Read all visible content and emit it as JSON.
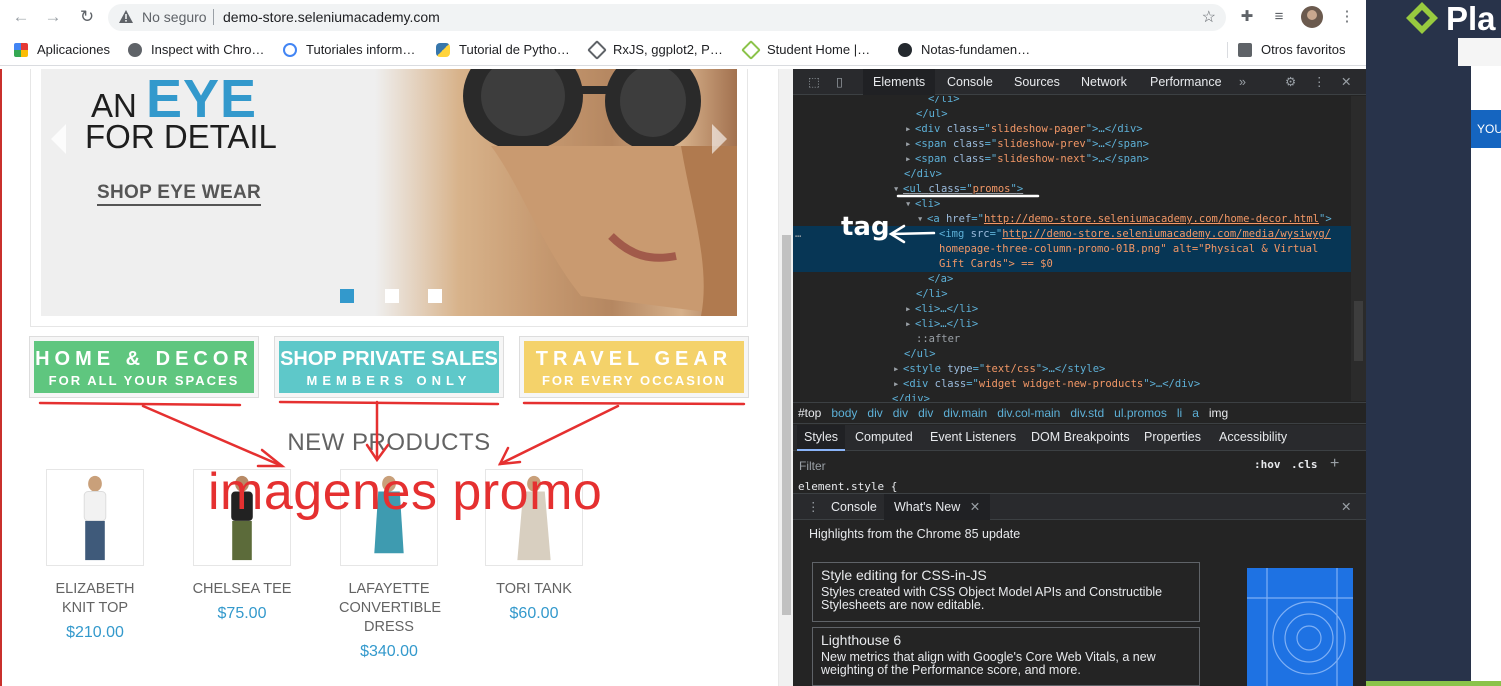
{
  "browser": {
    "insecure_label": "No seguro",
    "url": "demo-store.seleniumacademy.com",
    "bookmarks": [
      {
        "label": "Aplicaciones",
        "color": "#e53935"
      },
      {
        "label": "Inspect with Chro…",
        "color": "#5f6368"
      },
      {
        "label": "Tutoriales inform…",
        "color": "#4285f4"
      },
      {
        "label": "Tutorial de Pytho…",
        "color": "#3776ab"
      },
      {
        "label": "RxJS, ggplot2, P…",
        "color": "#5f6368"
      },
      {
        "label": "Student Home |…",
        "color": "#8bc34a"
      },
      {
        "label": "Notas-fundamen…",
        "color": "#24292e"
      }
    ],
    "other_bookmarks": "Otros favoritos"
  },
  "page": {
    "slide": {
      "line1_prefix": "AN",
      "line1_highlight": "EYE",
      "line2": "FOR DETAIL",
      "link": "SHOP EYE WEAR"
    },
    "promos": [
      {
        "title": "HOME & DECOR",
        "subtitle": "FOR ALL YOUR SPACES",
        "color": "#5fc67f"
      },
      {
        "title": "SHOP PRIVATE SALES",
        "subtitle": "MEMBERS ONLY",
        "color": "#5ec8c9"
      },
      {
        "title": "TRAVEL GEAR",
        "subtitle": "FOR EVERY OCCASION",
        "color": "#f4d26a"
      }
    ],
    "new_products_title": "NEW PRODUCTS",
    "products": [
      {
        "name": "ELIZABETH KNIT TOP",
        "price": "$210.00"
      },
      {
        "name": "CHELSEA TEE",
        "price": "$75.00"
      },
      {
        "name": "LAFAYETTE CONVERTIBLE DRESS",
        "price": "$340.00"
      },
      {
        "name": "TORI TANK",
        "price": "$60.00"
      }
    ]
  },
  "annotations": {
    "promo_label": "imagenes promo",
    "tag_label": "tag"
  },
  "devtools": {
    "tabs": [
      "Elements",
      "Console",
      "Sources",
      "Network",
      "Performance"
    ],
    "active_tab": "Elements",
    "dom_lines": [
      {
        "pre": "</li>"
      },
      {
        "pre": "</ul>"
      },
      {
        "tag": "div",
        "attr": "class",
        "val": "slideshow-pager",
        "post": ">…</div>"
      },
      {
        "tag": "span",
        "attr": "class",
        "val": "slideshow-prev",
        "post": ">…</span>"
      },
      {
        "tag": "span",
        "attr": "class",
        "val": "slideshow-next",
        "post": ">…</span>"
      },
      {
        "pre": "</div>"
      },
      {
        "tag": "ul",
        "attr": "class",
        "val": "promos",
        "post": ">"
      },
      {
        "pre": "<li>"
      },
      {
        "tag": "a",
        "attr": "href",
        "val": "http://demo-store.seleniumacademy.com/home-decor.html",
        "post": ">"
      },
      {
        "tag": "img",
        "attr": "src",
        "val": "http://demo-store.seleniumacademy.com/media/wysiwyg/"
      },
      {
        "pre": "homepage-three-column-promo-01B.png\" alt=\"Physical & Virtual"
      },
      {
        "pre": "Gift Cards\"> == $0"
      },
      {
        "pre": "</a>"
      },
      {
        "pre": "</li>"
      },
      {
        "pre": "<li>…</li>"
      },
      {
        "pre": "<li>…</li>"
      },
      {
        "pre": "::after"
      },
      {
        "pre": "</ul>"
      },
      {
        "tag": "style",
        "attr": "type",
        "val": "text/css",
        "post": ">…</style>"
      },
      {
        "tag": "div",
        "attr": "class",
        "val": "widget widget-new-products",
        "post": ">…</div>"
      },
      {
        "pre": "</div>"
      }
    ],
    "breadcrumbs": [
      "#top",
      "body",
      "div",
      "div",
      "div",
      "div.main",
      "div.col-main",
      "div.std",
      "ul.promos",
      "li",
      "a",
      "img"
    ],
    "subtabs": [
      "Styles",
      "Computed",
      "Event Listeners",
      "DOM Breakpoints",
      "Properties",
      "Accessibility"
    ],
    "filter_placeholder": "Filter",
    "hov": ":hov",
    "cls": ".cls",
    "element_style": "element.style {",
    "drawer_tabs": [
      "Console",
      "What's New"
    ],
    "whats_new_heading": "Highlights from the Chrome 85 update",
    "cards": [
      {
        "title": "Style editing for CSS-in-JS",
        "desc": "Styles created with CSS Object Model APIs and Constructible Stylesheets are now editable."
      },
      {
        "title": "Lighthouse 6",
        "desc": "New metrics that align with Google's Core Web Vitals, a new weighting of the Performance score, and more."
      }
    ]
  },
  "right_window": {
    "logo_text": "Pla",
    "banner_text": "YOU"
  }
}
